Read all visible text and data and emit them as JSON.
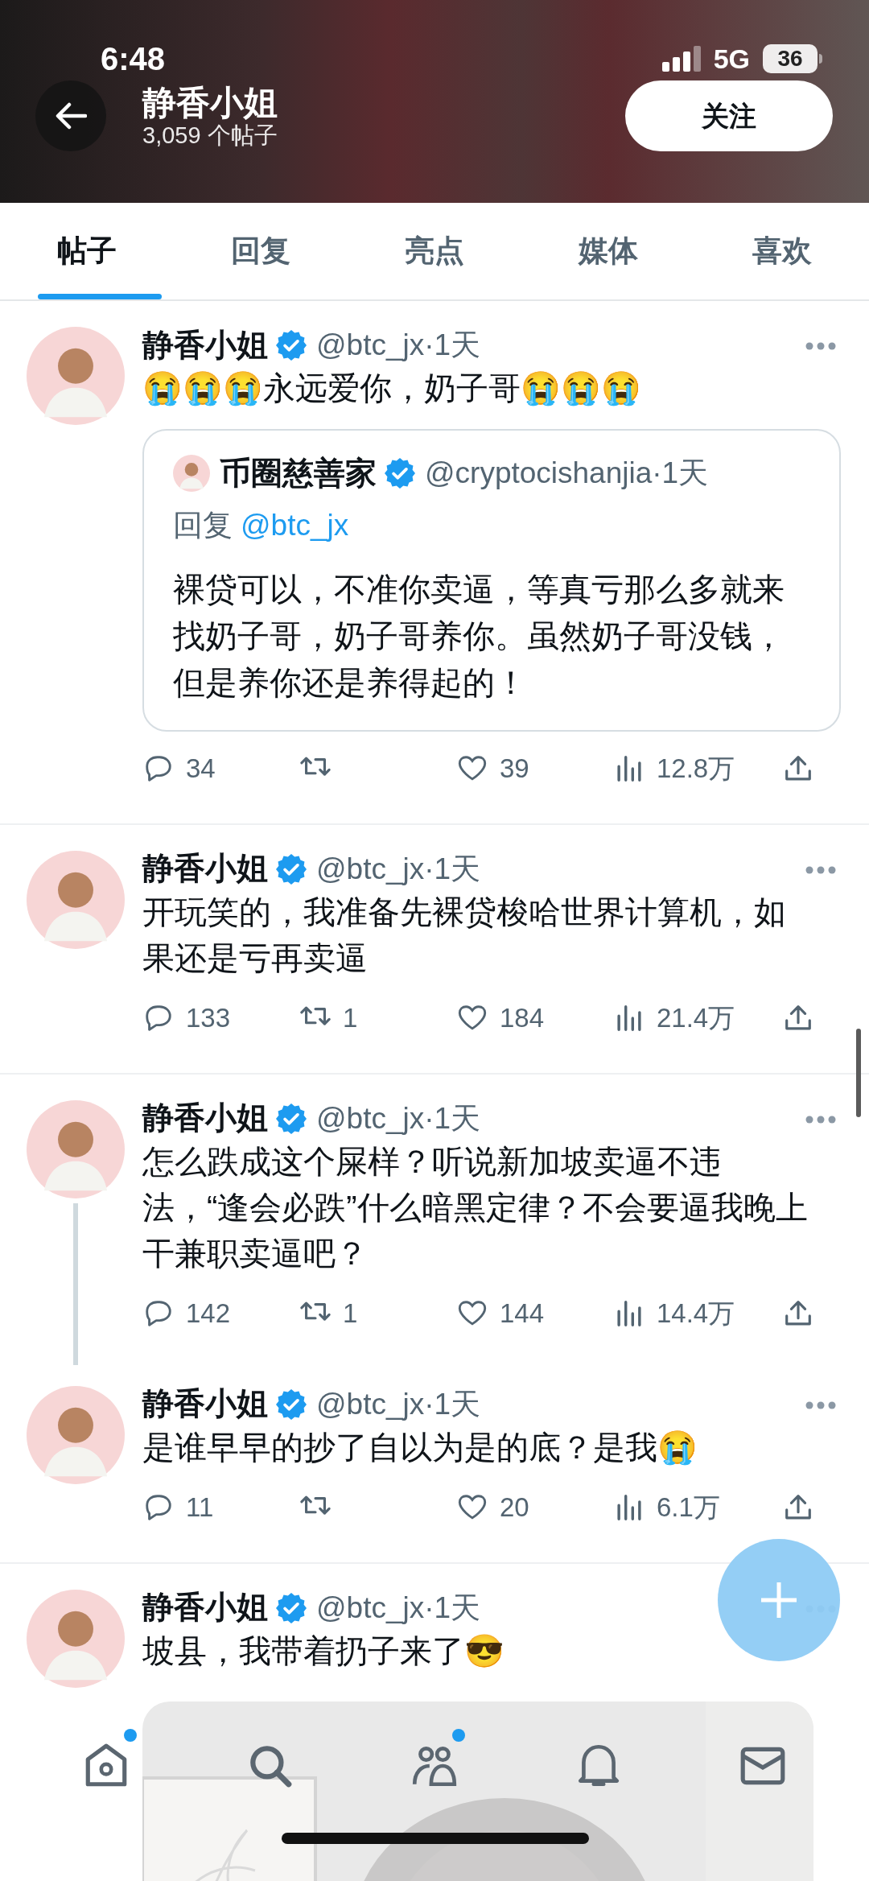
{
  "status_bar": {
    "time": "6:48",
    "network": "5G",
    "battery": "36"
  },
  "profile_header": {
    "name": "静香小姐",
    "post_count": "3,059 个帖子",
    "follow_button": "关注"
  },
  "tabs": [
    {
      "label": "帖子",
      "selected": true
    },
    {
      "label": "回复",
      "selected": false
    },
    {
      "label": "亮点",
      "selected": false
    },
    {
      "label": "媒体",
      "selected": false
    },
    {
      "label": "喜欢",
      "selected": false
    }
  ],
  "posts": [
    {
      "name": "静香小姐",
      "meta": "@btc_jx·1天",
      "text": "😭😭😭永远爱你，奶子哥😭😭😭",
      "quote": {
        "name": "币圈慈善家",
        "meta": "@cryptocishanjia·1天",
        "reply_label": "回复",
        "reply_to": "@btc_jx",
        "text": "裸贷可以，不准你卖逼，等真亏那么多就来找奶子哥，奶子哥养你。虽然奶子哥没钱，但是养你还是养得起的！"
      },
      "replies": "34",
      "likes": "39",
      "views": "12.8万",
      "thread_below": false
    },
    {
      "name": "静香小姐",
      "meta": "@btc_jx·1天",
      "text": "开玩笑的，我准备先裸贷梭哈世界计算机，如果还是亏再卖逼",
      "replies": "133",
      "reposts": "1",
      "likes": "184",
      "views": "21.4万",
      "thread_below": false
    },
    {
      "name": "静香小姐",
      "meta": "@btc_jx·1天",
      "text": "怎么跌成这个屎样？听说新加坡卖逼不违法，“逢会必跌”什么暗黑定律？不会要逼我晚上干兼职卖逼吧？",
      "replies": "142",
      "reposts": "1",
      "likes": "144",
      "views": "14.4万",
      "thread_below": true
    },
    {
      "name": "静香小姐",
      "meta": "@btc_jx·1天",
      "text": "是谁早早的抄了自以为是的底？是我😭",
      "replies": "11",
      "likes": "20",
      "views": "6.1万",
      "thread_below": false
    },
    {
      "name": "静香小姐",
      "meta": "@btc_jx·1天",
      "text": "坡县，我带着扔子来了😎"
    }
  ],
  "bottom_nav": [
    {
      "kind": "home",
      "badge": true
    },
    {
      "kind": "search",
      "badge": false
    },
    {
      "kind": "people",
      "badge": true
    },
    {
      "kind": "bell",
      "badge": false
    },
    {
      "kind": "mail",
      "badge": false
    }
  ]
}
